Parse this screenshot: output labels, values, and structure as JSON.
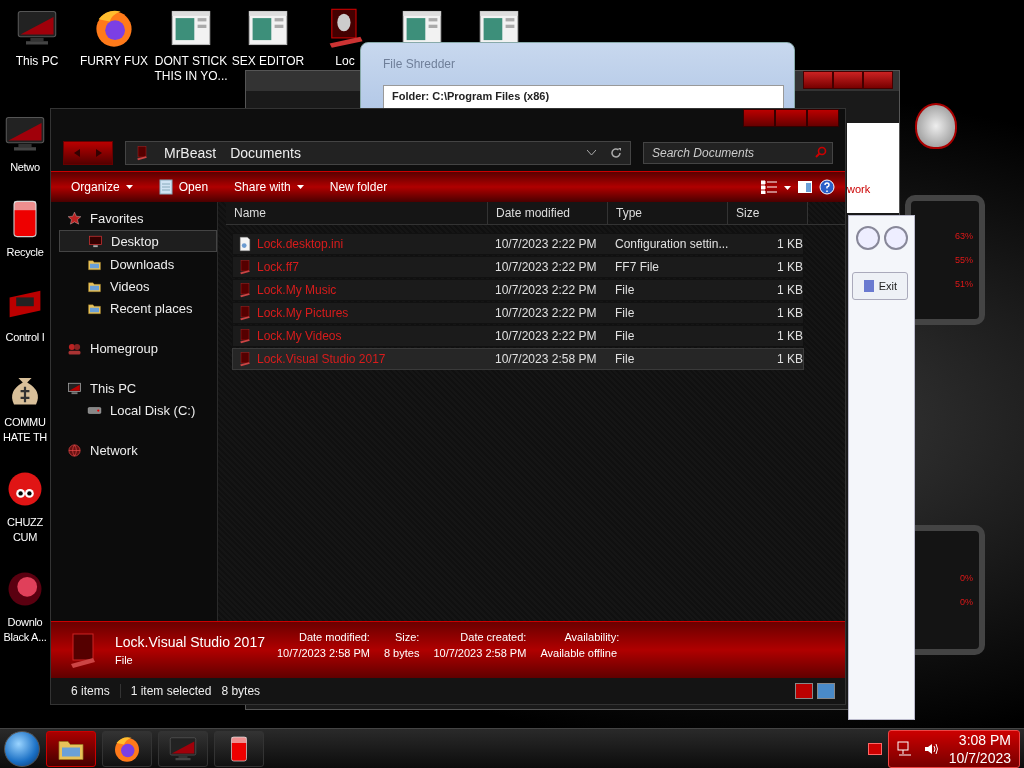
{
  "desktop_icons_top": [
    {
      "label": "This PC",
      "kind": "monitor"
    },
    {
      "label": "FURRY FUX",
      "kind": "firefox"
    },
    {
      "label": "DONT STICK THIS IN YO...",
      "kind": "app"
    },
    {
      "label": "SEX EDITOR",
      "kind": "app"
    },
    {
      "label": "Loc",
      "kind": "alien"
    },
    {
      "kind": "app"
    },
    {
      "kind": "app"
    }
  ],
  "desktop_icons_left": [
    {
      "label": "Netwo",
      "kind": "monitor"
    },
    {
      "label": "Recycle",
      "kind": "bin"
    },
    {
      "label": "Control I",
      "kind": "panel"
    },
    {
      "label": "COMMU HATE TH",
      "kind": "money"
    },
    {
      "label": "CHUZZ CUM",
      "kind": "fluff"
    },
    {
      "label": "Downlo Black A...",
      "kind": "orb"
    }
  ],
  "background_windows": {
    "window_behind": {
      "text": "work"
    },
    "file_shredder": {
      "title": "File Shredder",
      "folder": "Folder: C:\\Program Files (x86)"
    },
    "tool_window": {
      "button": "Exit"
    }
  },
  "gadgets": [
    {
      "readings": [
        "63%",
        "55%",
        "51%"
      ]
    },
    {
      "readings": [
        "0%",
        "0%"
      ]
    }
  ],
  "explorer": {
    "breadcrumb": [
      "MrBeast",
      "Documents"
    ],
    "search": {
      "placeholder": "Search Documents"
    },
    "toolbar": [
      {
        "label": "Organize",
        "kind": "menu"
      },
      {
        "label": "Open",
        "kind": "open"
      },
      {
        "label": "Share with",
        "kind": "menu"
      },
      {
        "label": "New folder",
        "kind": "plain"
      }
    ],
    "nav": [
      {
        "label": "Favorites",
        "kind": "star",
        "children": [
          {
            "label": "Desktop",
            "kind": "desktop",
            "selected": true
          },
          {
            "label": "Downloads",
            "kind": "folder",
            "selected": false
          },
          {
            "label": "Videos",
            "kind": "folder",
            "selected": false
          },
          {
            "label": "Recent places",
            "kind": "folder",
            "selected": false
          }
        ]
      },
      {
        "label": "Homegroup",
        "kind": "group"
      },
      {
        "label": "This PC",
        "kind": "pc",
        "children": [
          {
            "label": "Local Disk (C:)",
            "kind": "disk",
            "selected": false
          }
        ]
      },
      {
        "label": "Network",
        "kind": "net"
      }
    ],
    "columns": [
      "Name",
      "Date modified",
      "Type",
      "Size"
    ],
    "files": [
      {
        "name": "Lock.desktop.ini",
        "date": "10/7/2023 2:22 PM",
        "type": "Configuration settin...",
        "size": "1 KB",
        "kind": "settings",
        "selected": false
      },
      {
        "name": "Lock.ff7",
        "date": "10/7/2023 2:22 PM",
        "type": "FF7 File",
        "size": "1 KB",
        "kind": "file",
        "selected": false
      },
      {
        "name": "Lock.My Music",
        "date": "10/7/2023 2:22 PM",
        "type": "File",
        "size": "1 KB",
        "kind": "file",
        "selected": false
      },
      {
        "name": "Lock.My Pictures",
        "date": "10/7/2023 2:22 PM",
        "type": "File",
        "size": "1 KB",
        "kind": "file",
        "selected": false
      },
      {
        "name": "Lock.My Videos",
        "date": "10/7/2023 2:22 PM",
        "type": "File",
        "size": "1 KB",
        "kind": "file",
        "selected": false
      },
      {
        "name": "Lock.Visual Studio 2017",
        "date": "10/7/2023 2:58 PM",
        "type": "File",
        "size": "1 KB",
        "kind": "file",
        "selected": true
      }
    ],
    "details": {
      "name": "Lock.Visual Studio 2017",
      "type": "File",
      "fields": [
        {
          "label": "Date modified:",
          "value": "10/7/2023 2:58 PM"
        },
        {
          "label": "Size:",
          "value": "8 bytes"
        },
        {
          "label": "Date created:",
          "value": "10/7/2023 2:58 PM"
        },
        {
          "label": "Availability:",
          "value": "Available offline"
        }
      ]
    },
    "status": {
      "count": "6 items",
      "selection": "1 item selected",
      "size": "8 bytes"
    }
  },
  "taskbar": {
    "pinned": [
      {
        "kind": "folder",
        "selected": true
      },
      {
        "kind": "firefox",
        "selected": false
      },
      {
        "kind": "monitor",
        "selected": false
      },
      {
        "kind": "bin",
        "selected": false
      }
    ],
    "clock": {
      "time": "3:08 PM",
      "date": "10/7/2023"
    }
  }
}
